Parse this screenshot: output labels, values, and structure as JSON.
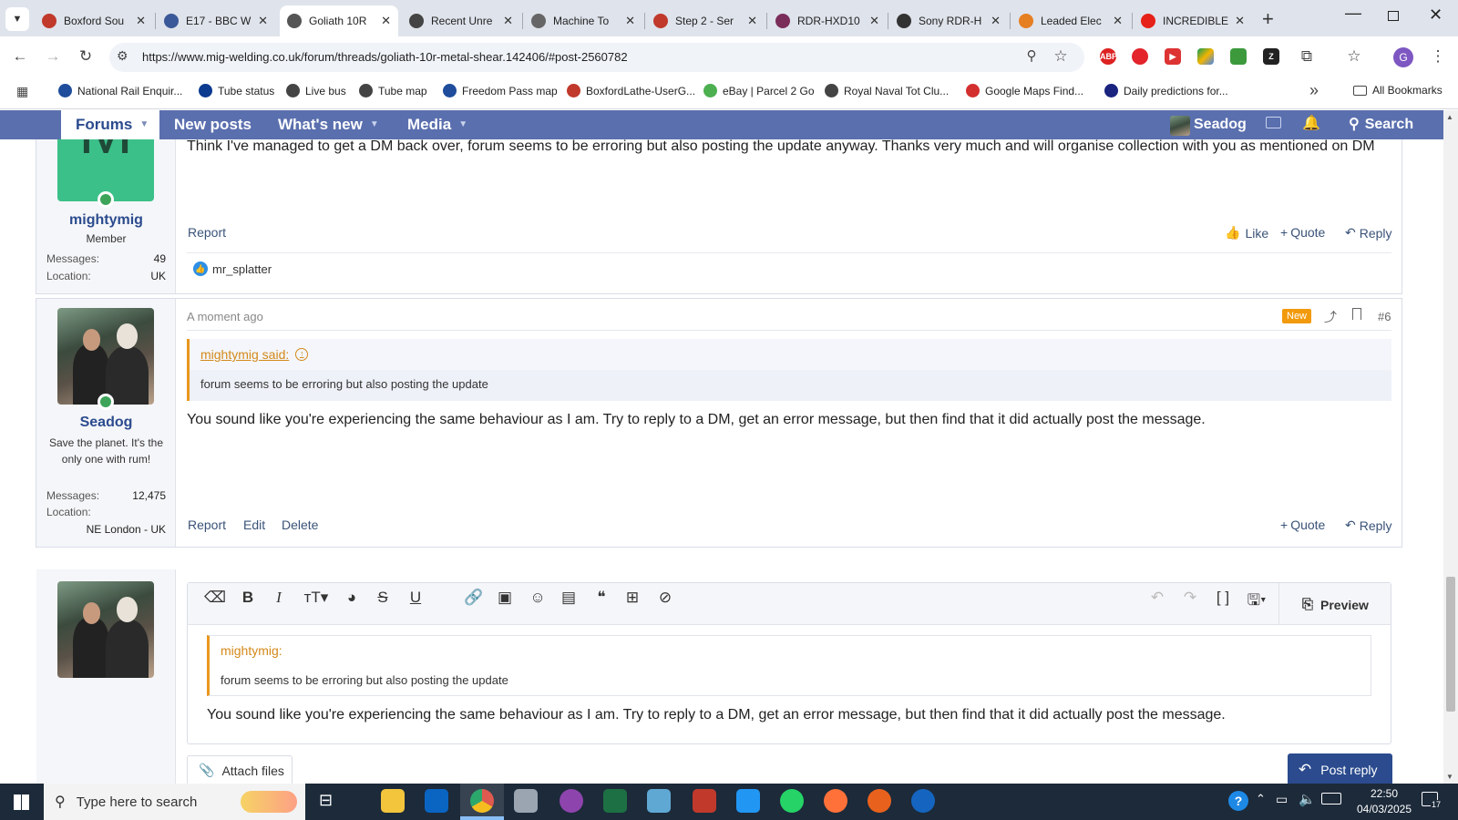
{
  "browser": {
    "tabs": [
      {
        "title": "Boxford Sou",
        "color": "#c0392b"
      },
      {
        "title": "E17 - BBC W",
        "color": "#3b5998"
      },
      {
        "title": "Goliath 10R",
        "color": "#555555"
      },
      {
        "title": "Recent Unre",
        "color": "#444444"
      },
      {
        "title": "Machine To",
        "color": "#666666"
      },
      {
        "title": "Step 2 - Ser",
        "color": "#c0392b"
      },
      {
        "title": "RDR-HXD10",
        "color": "#7b2d5a"
      },
      {
        "title": "Sony RDR-H",
        "color": "#333333"
      },
      {
        "title": "Leaded Elec",
        "color": "#e67e22"
      },
      {
        "title": "INCREDIBLE",
        "color": "#e62117"
      }
    ],
    "close_glyph": "✕",
    "new_tab_glyph": "+",
    "url": "https://www.mig-welding.co.uk/forum/threads/goliath-10r-metal-shear.142406/#post-2560782",
    "profile_initial": "G",
    "bookmarks": [
      {
        "label": "National Rail Enquir...",
        "color": "#1f4d9c"
      },
      {
        "label": "Tube status",
        "color": "#0b3a8f"
      },
      {
        "label": "Live bus",
        "color": "#444444"
      },
      {
        "label": "Tube map",
        "color": "#444444"
      },
      {
        "label": "Freedom Pass map",
        "color": "#1f4d9c"
      },
      {
        "label": "BoxfordLathe-UserG...",
        "color": "#c0392b"
      },
      {
        "label": "eBay | Parcel 2 Go",
        "color": "#4caf50"
      },
      {
        "label": "Royal Naval Tot Clu...",
        "color": "#444444"
      },
      {
        "label": "Google Maps Find...",
        "color": "#d32f2f"
      },
      {
        "label": "Daily predictions for...",
        "color": "#1a237e"
      }
    ],
    "bookmarks_more": "»",
    "all_bookmarks": "All Bookmarks"
  },
  "forum_nav": {
    "forums": "Forums",
    "new_posts": "New posts",
    "whats_new": "What's new",
    "media": "Media",
    "username": "Seadog",
    "search": "Search"
  },
  "post1": {
    "avatar_letter": "M",
    "avatar_color": "#3bc089",
    "username": "mightymig",
    "user_title": "Member",
    "messages_label": "Messages:",
    "messages_value": "49",
    "location_label": "Location:",
    "location_value": "UK",
    "text": "Think I've managed to get a DM back over, forum seems to be erroring but also posting the update anyway. Thanks very much and will organise collection with you as mentioned on DM",
    "report": "Report",
    "like": "Like",
    "quote": "Quote",
    "reply": "Reply",
    "liked_by": "mr_splatter"
  },
  "post2": {
    "username": "Seadog",
    "user_title": "Save the planet. It's the only one with rum!",
    "messages_label": "Messages:",
    "messages_value": "12,475",
    "location_label": "Location:",
    "location_value": "NE London - UK",
    "time": "A moment ago",
    "new_badge": "New",
    "post_number": "#6",
    "quote_author": "mightymig said:",
    "quote_text": "forum seems to be erroring but also posting the update",
    "text": "You sound like you're experiencing the same behaviour as I am. Try to reply to a DM, get an error message, but then find that it did actually post the message.",
    "report": "Report",
    "edit": "Edit",
    "delete": "Delete",
    "quote": "Quote",
    "reply": "Reply"
  },
  "editor": {
    "preview": "Preview",
    "quote_author": "mightymig:",
    "quote_text": "forum seems to be erroring but also posting the update",
    "body": "You sound like you're experiencing the same behaviour as I am. Try to reply to a DM, get an error message, but then find that it did actually post the message.",
    "attach": "Attach files",
    "post_reply": "Post reply"
  },
  "taskbar": {
    "search_placeholder": "Type here to search",
    "time": "22:50",
    "date": "04/03/2025",
    "notification_count": "17",
    "apps": [
      {
        "name": "file-explorer",
        "color": "#f2c53d"
      },
      {
        "name": "outlook",
        "color": "#0a64c2"
      },
      {
        "name": "chrome",
        "color": "#db4437"
      },
      {
        "name": "remote-desktop",
        "color": "#9aa5b1"
      },
      {
        "name": "photos",
        "color": "#8e44ad"
      },
      {
        "name": "excel",
        "color": "#1d7044"
      },
      {
        "name": "paint",
        "color": "#5fa8d3"
      },
      {
        "name": "red-app",
        "color": "#c0392b"
      },
      {
        "name": "blue-app",
        "color": "#2196f3"
      },
      {
        "name": "whatsapp",
        "color": "#25d366"
      },
      {
        "name": "firefox-like",
        "color": "#ff7139"
      },
      {
        "name": "orange-app",
        "color": "#e8621d"
      },
      {
        "name": "blue-arc-app",
        "color": "#1565c0"
      }
    ]
  }
}
